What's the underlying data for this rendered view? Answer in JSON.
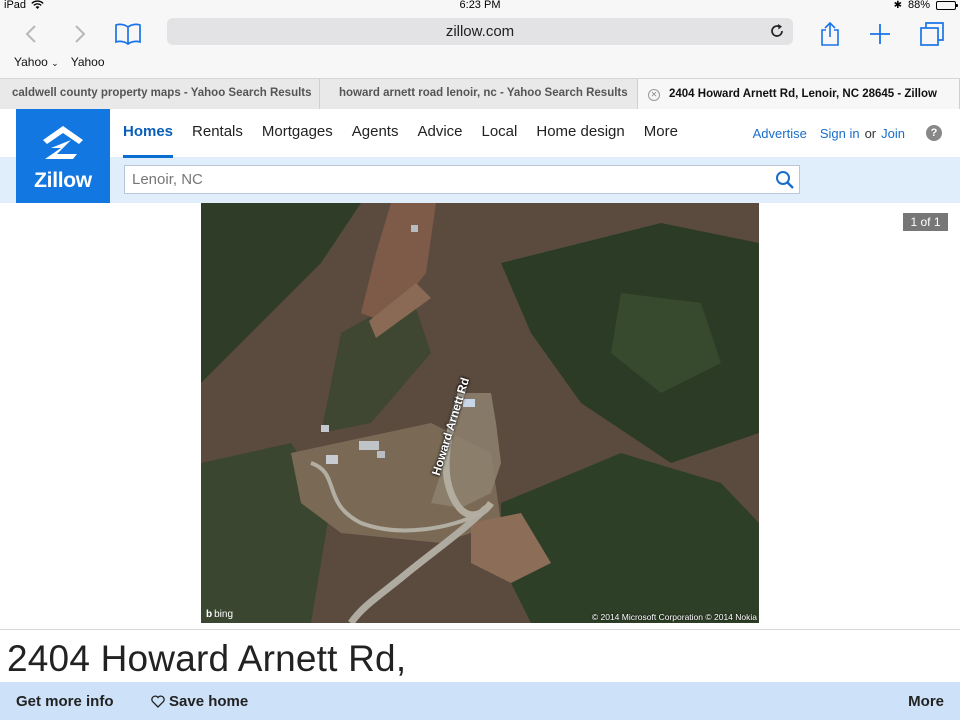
{
  "statusbar": {
    "device": "iPad",
    "time": "6:23 PM",
    "battery": "88%"
  },
  "browser": {
    "url": "zillow.com",
    "bookmarks": [
      "Yahoo",
      "Yahoo"
    ],
    "tabs": [
      {
        "title": "caldwell county property maps - Yahoo Search Results"
      },
      {
        "title": "howard arnett road lenoir, nc - Yahoo Search Results"
      },
      {
        "title": "2404 Howard Arnett Rd, Lenoir, NC 28645 - Zillow"
      }
    ]
  },
  "zillow": {
    "logo": "Zillow",
    "nav": [
      "Homes",
      "Rentals",
      "Mortgages",
      "Agents",
      "Advice",
      "Local",
      "Home design",
      "More"
    ],
    "user": {
      "advertise": "Advertise",
      "sign_in": "Sign in",
      "or": "or",
      "join": "Join",
      "help": "?"
    },
    "search": {
      "value": "Lenoir, NC"
    },
    "colors": {
      "brand": "#1277e1",
      "subbar": "#dfeefa",
      "link": "#1a6ec9"
    }
  },
  "listing": {
    "photo": {
      "counter": "1 of 1",
      "road_label": "Howard Arnett Rd",
      "attribution": "bing",
      "copyright": "© 2014 Microsoft Corporation © 2014 Nokia"
    },
    "address_line1": "2404 Howard Arnett Rd,"
  },
  "actions": {
    "more_info": "Get more info",
    "save": "Save home",
    "more": "More"
  }
}
